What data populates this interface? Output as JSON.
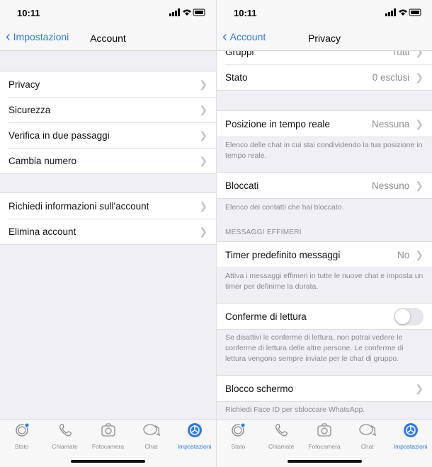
{
  "left": {
    "time": "10:11",
    "back_label": "Impostazioni",
    "title": "Account",
    "group1": [
      {
        "label": "Privacy"
      },
      {
        "label": "Sicurezza"
      },
      {
        "label": "Verifica in due passaggi"
      },
      {
        "label": "Cambia numero"
      }
    ],
    "group2": [
      {
        "label": "Richiedi informazioni sull'account"
      },
      {
        "label": "Elimina account"
      }
    ]
  },
  "right": {
    "time": "10:11",
    "back_label": "Account",
    "title": "Privacy",
    "gruppi": {
      "label": "Gruppi",
      "value": "Tutti"
    },
    "stato": {
      "label": "Stato",
      "value": "0 esclusi"
    },
    "posizione": {
      "label": "Posizione in tempo reale",
      "value": "Nessuna",
      "footer": "Elenco delle chat in cui stai condividendo la tua posizione in tempo reale."
    },
    "bloccati": {
      "label": "Bloccati",
      "value": "Nessuno",
      "footer": "Elenco dei contatti che hai bloccato."
    },
    "messaggi_effimeri_header": "MESSAGGI EFFIMERI",
    "timer": {
      "label": "Timer predefinito messaggi",
      "value": "No",
      "footer": "Attiva i messaggi effimeri in tutte le nuove chat e imposta un timer per definirne la durata."
    },
    "conferme": {
      "label": "Conferme di lettura",
      "enabled": false,
      "footer": "Se disattivi le conferme di lettura, non potrai vedere le conferme di lettura delle altre persone. Le conferme di lettura vengono sempre inviate per le chat di gruppo."
    },
    "blocco": {
      "label": "Blocco schermo",
      "footer": "Richiedi Face ID per sbloccare WhatsApp."
    }
  },
  "tabs": [
    {
      "label": "Stato",
      "icon": "status-icon"
    },
    {
      "label": "Chiamate",
      "icon": "phone-icon"
    },
    {
      "label": "Fotocamera",
      "icon": "camera-icon"
    },
    {
      "label": "Chat",
      "icon": "chat-icon"
    },
    {
      "label": "Impostazioni",
      "icon": "gear-icon",
      "active": true
    }
  ],
  "colors": {
    "accent": "#2f7ae5",
    "background": "#efeff4"
  }
}
